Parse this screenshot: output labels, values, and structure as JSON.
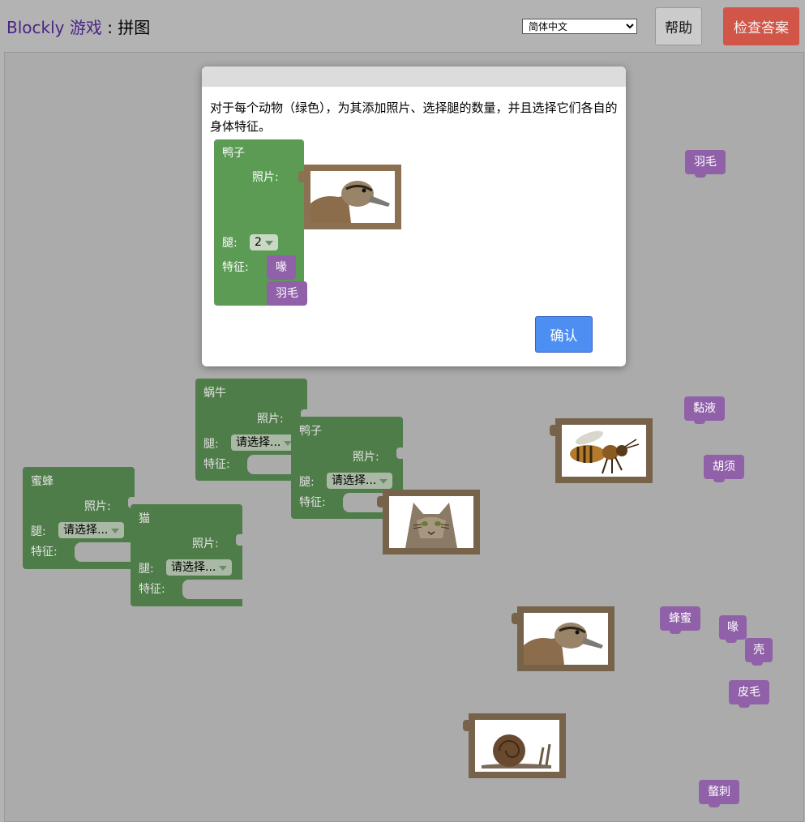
{
  "header": {
    "brand": "Blockly 游戏",
    "separator": " : ",
    "game": "拼图",
    "language": "简体中文",
    "help_label": "帮助",
    "check_label": "检查答案"
  },
  "dialog": {
    "text": "对于每个动物（绿色），为其添加照片、选择腿的数量，并且选择它们各自的身体特征。",
    "ok_label": "确认",
    "example": {
      "name": "鸭子",
      "photo_label": "照片:",
      "legs_label": "腿:",
      "legs_value": "2",
      "traits_label": "特征:",
      "traits": [
        "喙",
        "羽毛"
      ],
      "photo": "duck-photo"
    }
  },
  "animals": [
    {
      "name": "蜗牛",
      "photo_label": "照片:",
      "legs_label": "腿:",
      "legs_value": "请选择...",
      "traits_label": "特征:"
    },
    {
      "name": "鸭子",
      "photo_label": "照片:",
      "legs_label": "腿:",
      "legs_value": "请选择...",
      "traits_label": "特征:"
    },
    {
      "name": "蜜蜂",
      "photo_label": "照片:",
      "legs_label": "腿:",
      "legs_value": "请选择...",
      "traits_label": "特征:"
    },
    {
      "name": "猫",
      "photo_label": "照片:",
      "legs_label": "腿:",
      "legs_value": "请选择...",
      "traits_label": "特征:"
    }
  ],
  "pictures": [
    "bee-photo",
    "cat-photo",
    "duck-photo",
    "snail-photo"
  ],
  "traits": [
    "羽毛",
    "黏液",
    "胡须",
    "蜂蜜",
    "喙",
    "壳",
    "皮毛",
    "螯刺"
  ],
  "colors": {
    "animal_block": "#5b9b54",
    "trait_block": "#9060a8",
    "picture_block": "#8b7152",
    "ok_button": "#4c8ef2",
    "check_button": "#d9402e"
  }
}
